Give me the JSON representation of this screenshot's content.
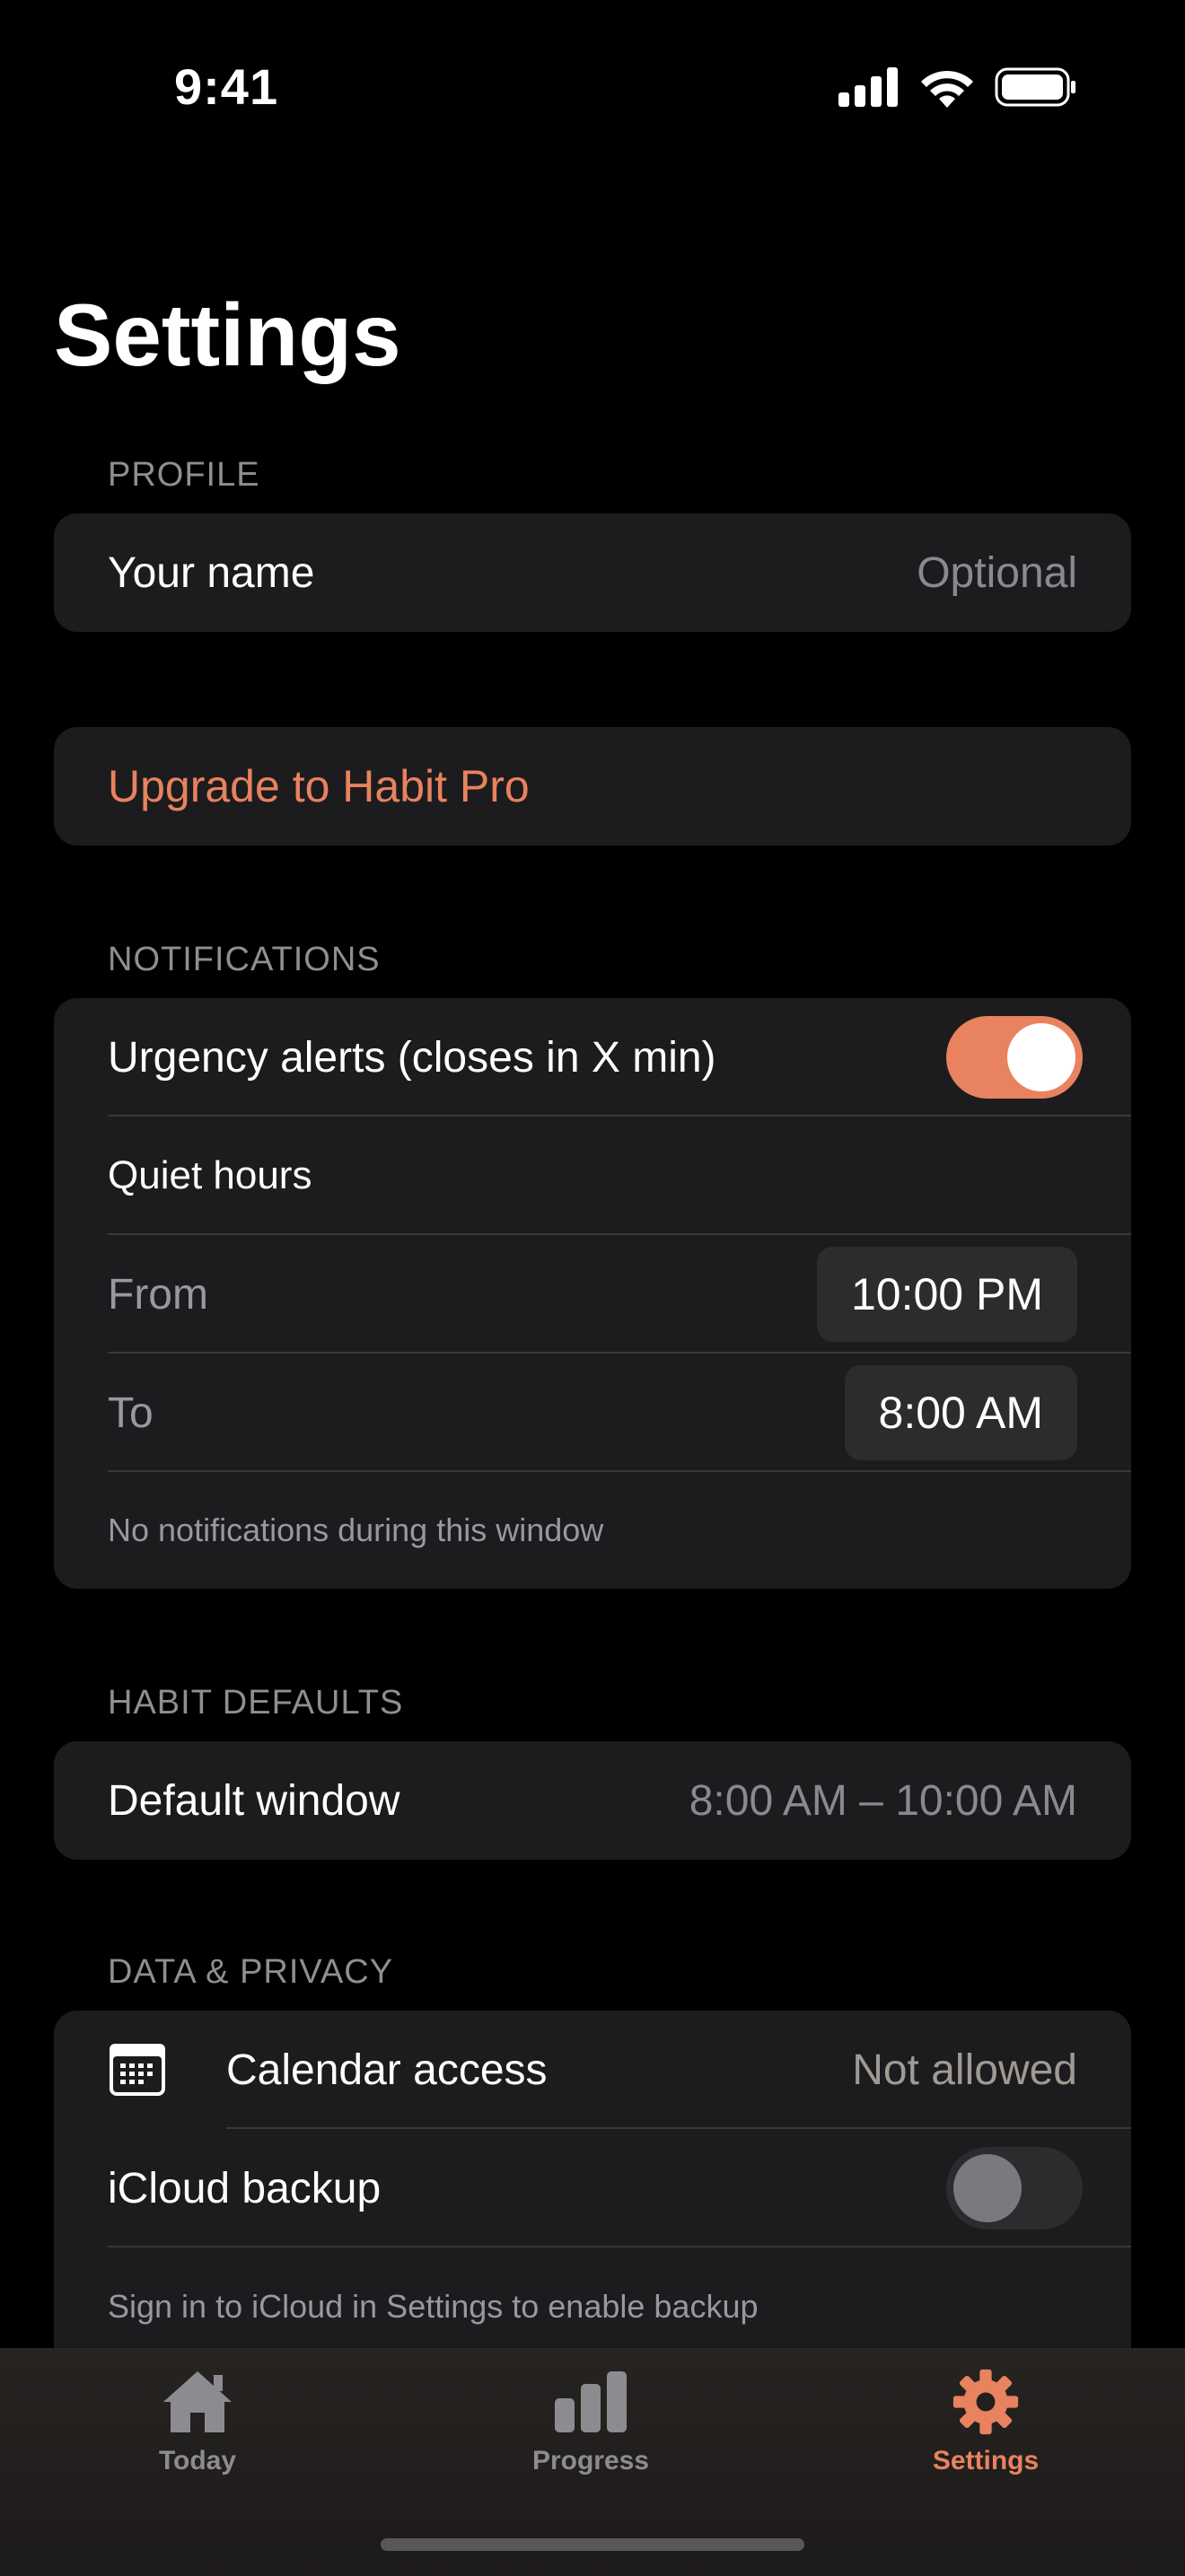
{
  "status_bar": {
    "time": "9:41"
  },
  "page": {
    "title": "Settings"
  },
  "profile": {
    "header": "PROFILE",
    "name_label": "Your name",
    "name_placeholder": "Optional"
  },
  "upgrade": {
    "label": "Upgrade to Habit Pro"
  },
  "notifications": {
    "header": "NOTIFICATIONS",
    "urgency_label": "Urgency alerts (closes in X min)",
    "urgency_enabled": true,
    "quiet_hours_label": "Quiet hours",
    "from_label": "From",
    "from_value": "10:00 PM",
    "to_label": "To",
    "to_value": "8:00 AM",
    "footnote": "No notifications during this window"
  },
  "habit_defaults": {
    "header": "HABIT DEFAULTS",
    "window_label": "Default window",
    "window_value": "8:00 AM – 10:00 AM"
  },
  "data_privacy": {
    "header": "DATA & PRIVACY",
    "calendar_label": "Calendar access",
    "calendar_value": "Not allowed",
    "calendar_icon": "calendar-icon",
    "icloud_label": "iCloud backup",
    "icloud_enabled": false,
    "icloud_footnote": "Sign in to iCloud in Settings to enable backup"
  },
  "tab_bar": {
    "tabs": [
      {
        "label": "Today",
        "icon": "house-icon",
        "active": false
      },
      {
        "label": "Progress",
        "icon": "bar-chart-icon",
        "active": false
      },
      {
        "label": "Settings",
        "icon": "gear-icon",
        "active": true
      }
    ]
  },
  "colors": {
    "accent": "#e8825f",
    "background": "#000000",
    "card": "#1c1c1e",
    "secondary_text": "#8e8e93"
  }
}
